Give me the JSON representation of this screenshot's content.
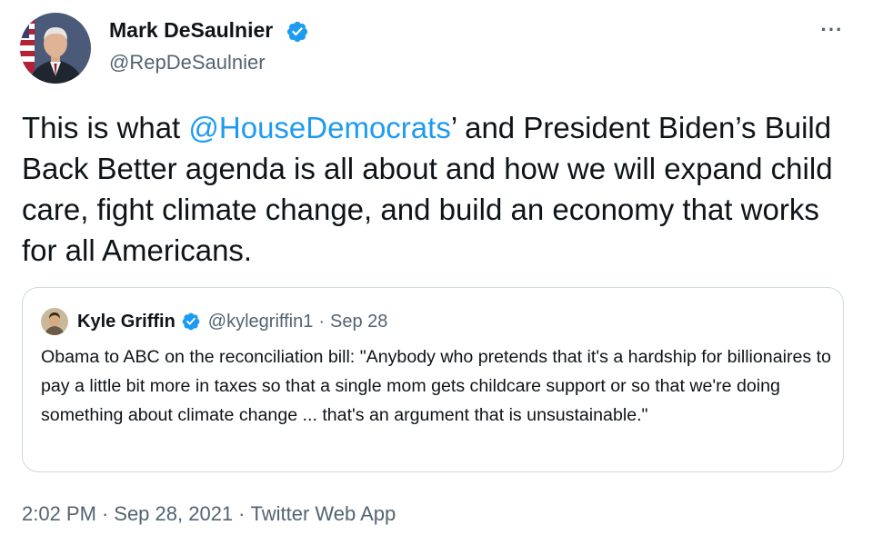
{
  "author": {
    "display_name": "Mark DeSaulnier",
    "handle": "@RepDeSaulnier",
    "avatar_icon": "profile-photo",
    "verified_icon": "verified-badge-icon"
  },
  "more_button": {
    "label": "···",
    "icon": "more-options-icon"
  },
  "tweet": {
    "text_before": "This is what ",
    "mention": "@HouseDemocrats",
    "text_after": "’ and President Biden’s Build Back Better agenda is all about and how we will expand child care, fight climate change, and build an economy that works for all Americans."
  },
  "quoted_tweet": {
    "display_name": "Kyle Griffin",
    "handle": "@kylegriffin1",
    "dot": "·",
    "date": "Sep 28",
    "text": "Obama to ABC on the reconciliation bill: \"Anybody who pretends that it's a hardship for billionaires to pay a little bit more in taxes so that a single mom gets childcare support or so that we're doing something about climate change ... that's an argument that is unsustainable.\""
  },
  "meta": {
    "time": "2:02 PM",
    "sep1": "·",
    "date": "Sep 28, 2021",
    "sep2": "·",
    "source": "Twitter Web App"
  },
  "colors": {
    "link": "#1d9bf0",
    "secondary_text": "#536471",
    "primary_text": "#0f1419",
    "border": "#cfd9de"
  }
}
